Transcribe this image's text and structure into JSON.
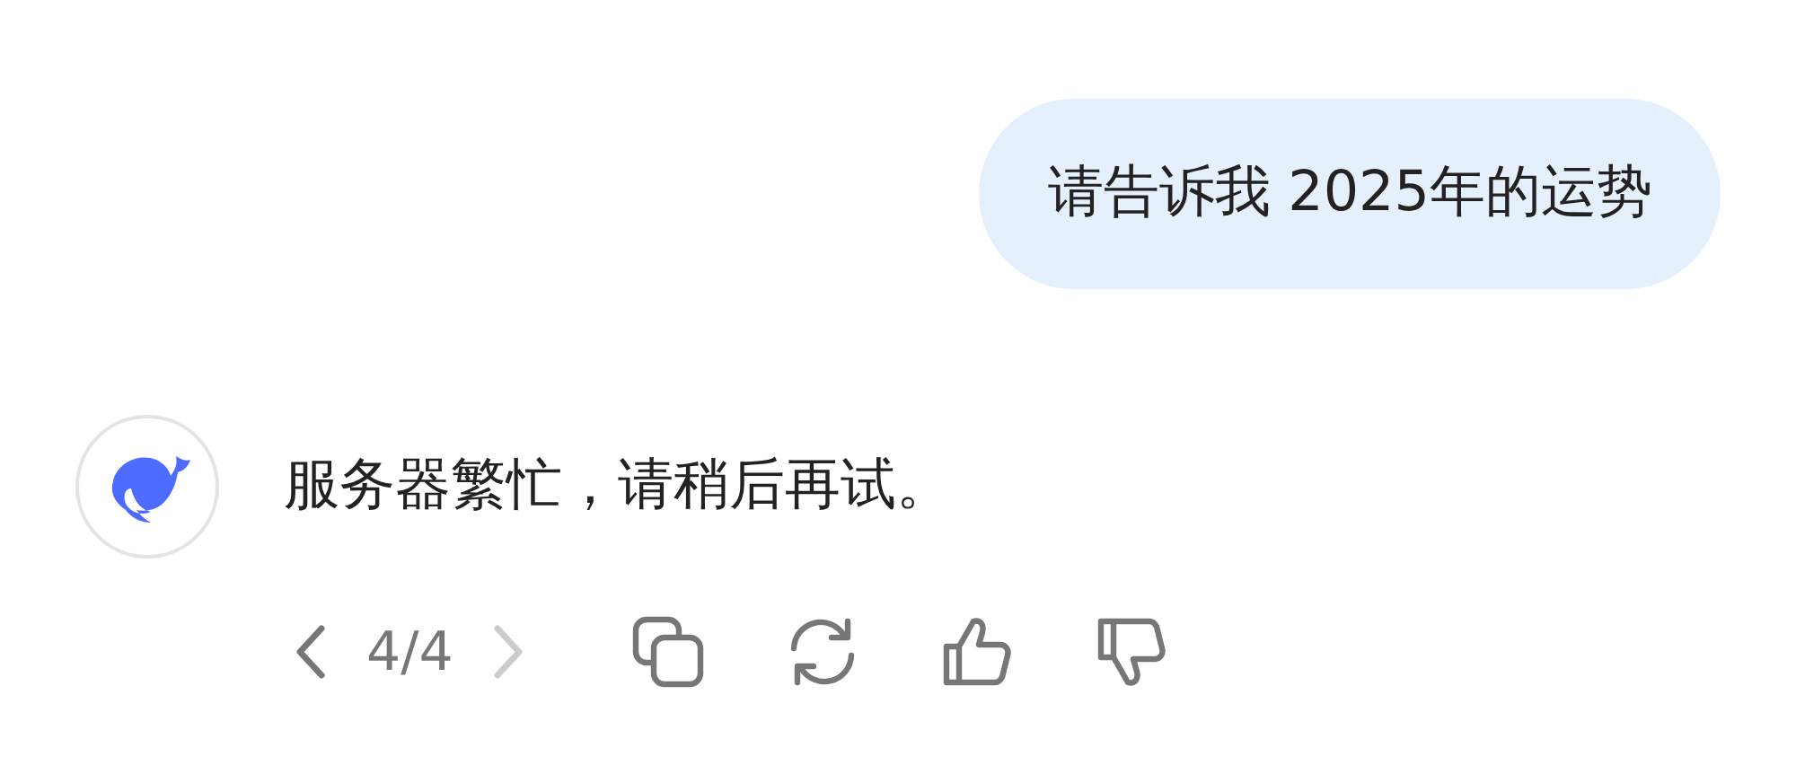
{
  "user_message": {
    "text": "请告诉我 2025年的运势"
  },
  "assistant_message": {
    "text": "服务器繁忙，请稍后再试。"
  },
  "pager": {
    "text": "4/4",
    "prev_disabled": false,
    "next_disabled": true
  },
  "actions": [
    {
      "kind": "copy"
    },
    {
      "kind": "regenerate"
    },
    {
      "kind": "like"
    },
    {
      "kind": "dislike"
    }
  ]
}
